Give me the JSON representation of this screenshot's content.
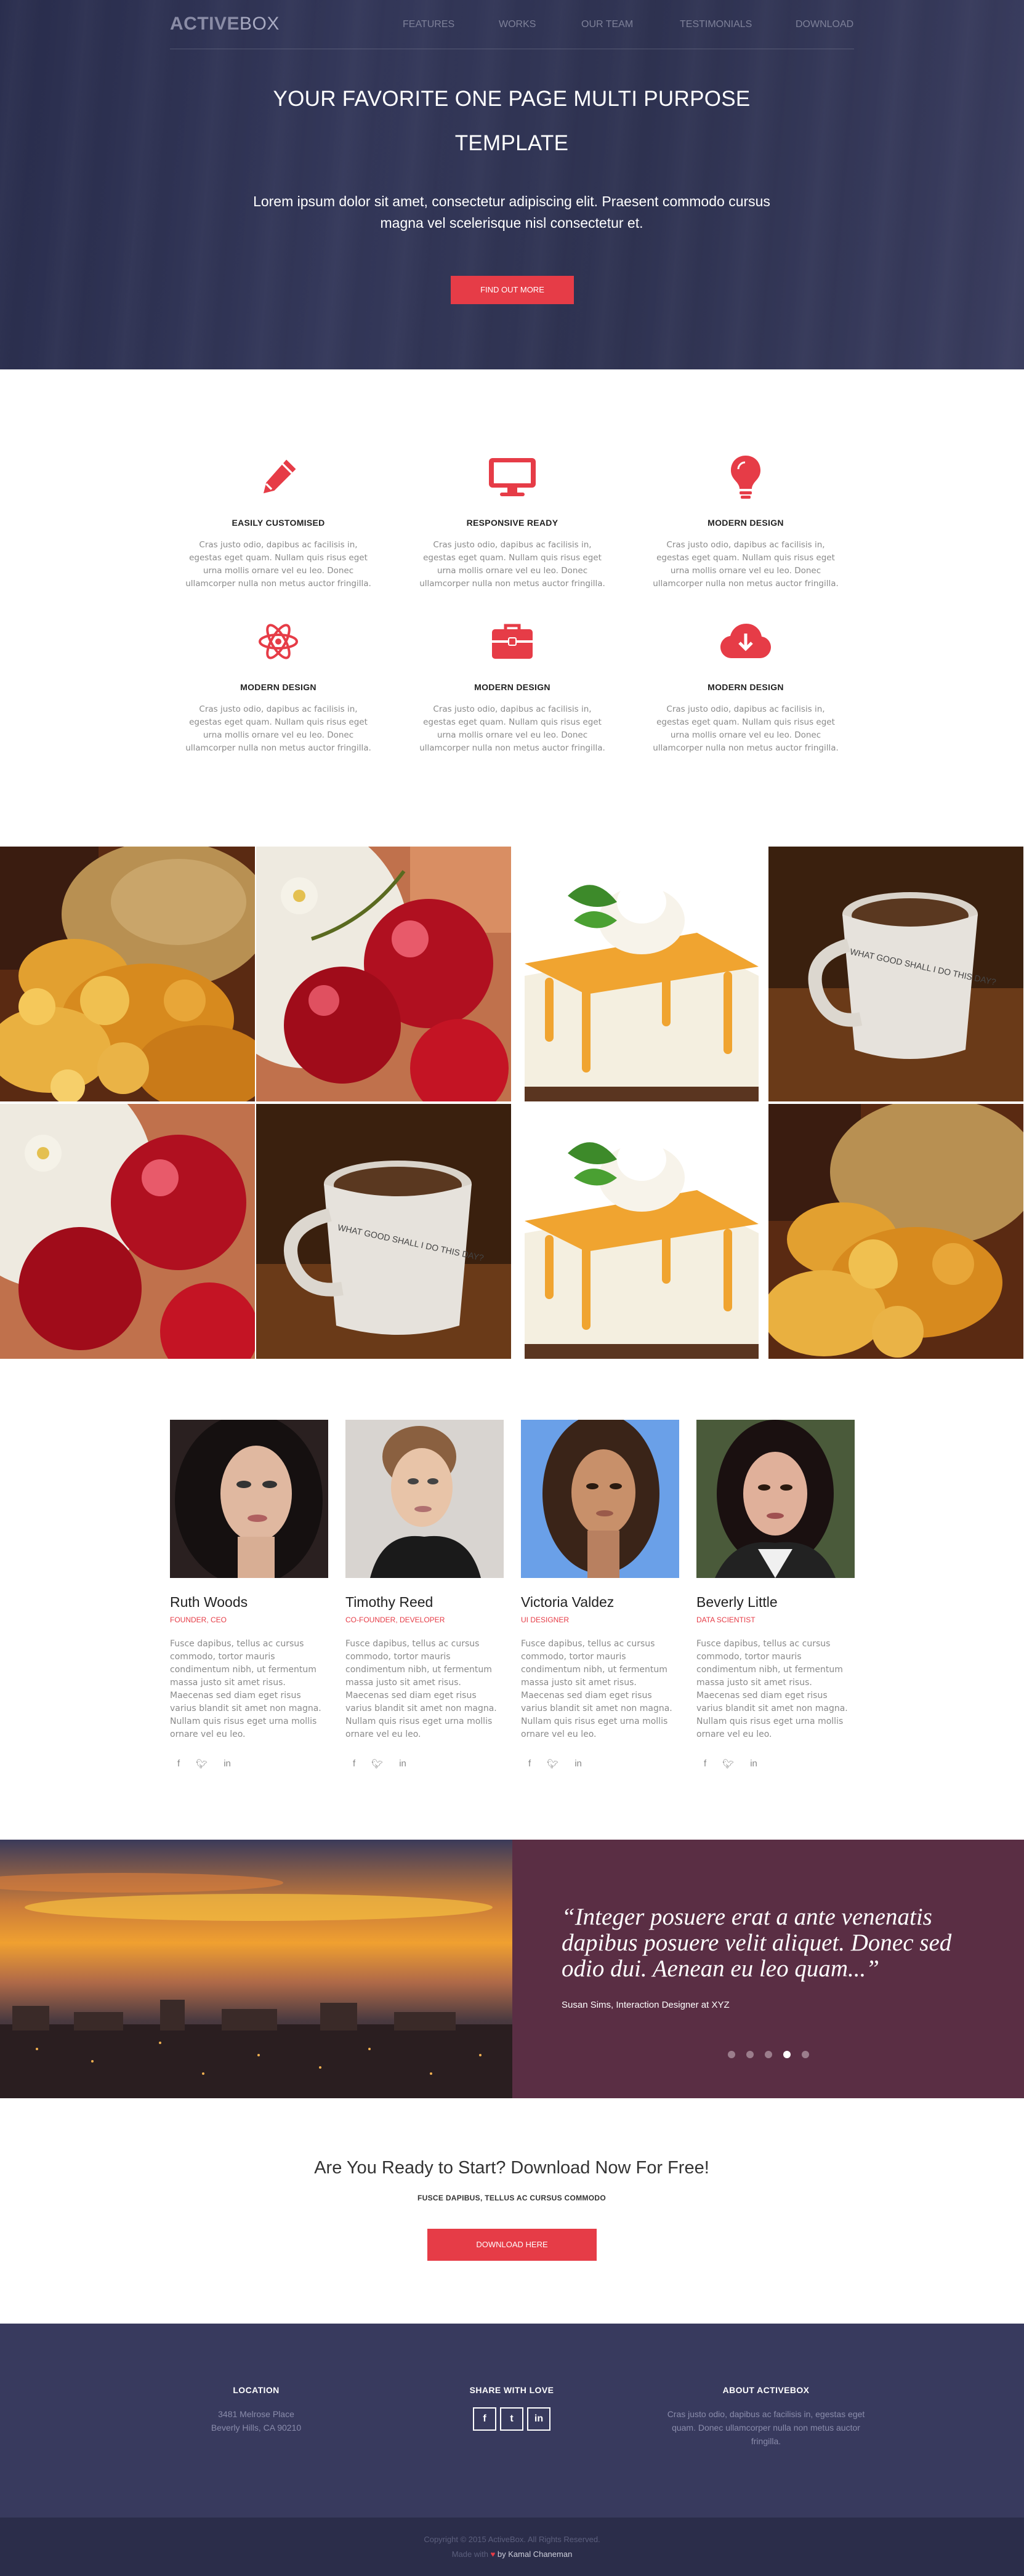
{
  "brand": {
    "logo_bold": "ACTIVE",
    "logo_light": "BOX"
  },
  "nav": {
    "items": [
      "FEATURES",
      "WORKS",
      "OUR TEAM",
      "TESTIMONIALS",
      "DOWNLOAD"
    ]
  },
  "hero": {
    "title_line1": "YOUR FAVORITE ONE PAGE MULTI PURPOSE",
    "title_line2": "TEMPLATE",
    "text": "Lorem ipsum dolor sit amet, consectetur adipiscing elit. Praesent commodo cursus magna vel scelerisque nisl consectetur et.",
    "button": "FIND OUT MORE"
  },
  "features": [
    {
      "title": "EASILY CUSTOMISED",
      "icon": "pencil-icon",
      "text": "Cras justo odio, dapibus ac facilisis in, egestas eget quam. Nullam quis risus eget urna mollis ornare vel eu leo. Donec ullamcorper nulla non metus auctor fringilla."
    },
    {
      "title": "RESPONSIVE READY",
      "icon": "monitor-icon",
      "text": "Cras justo odio, dapibus ac facilisis in, egestas eget quam. Nullam quis risus eget urna mollis ornare vel eu leo. Donec ullamcorper nulla non metus auctor fringilla."
    },
    {
      "title": "MODERN DESIGN",
      "icon": "lightbulb-icon",
      "text": "Cras justo odio, dapibus ac facilisis in, egestas eget quam. Nullam quis risus eget urna mollis ornare vel eu leo. Donec ullamcorper nulla non metus auctor fringilla."
    },
    {
      "title": "MODERN DESIGN",
      "icon": "atom-icon",
      "text": "Cras justo odio, dapibus ac facilisis in, egestas eget quam. Nullam quis risus eget urna mollis ornare vel eu leo. Donec ullamcorper nulla non metus auctor fringilla."
    },
    {
      "title": "MODERN DESIGN",
      "icon": "briefcase-icon",
      "text": "Cras justo odio, dapibus ac facilisis in, egestas eget quam. Nullam quis risus eget urna mollis ornare vel eu leo. Donec ullamcorper nulla non metus auctor fringilla."
    },
    {
      "title": "MODERN DESIGN",
      "icon": "cloud-download-icon",
      "text": "Cras justo odio, dapibus ac facilisis in, egestas eget quam. Nullam quis risus eget urna mollis ornare vel eu leo. Donec ullamcorper nulla non metus auctor fringilla."
    }
  ],
  "gallery": [
    "pastries",
    "cherries",
    "cheesecake",
    "coffee-mug",
    "cherries",
    "coffee-mug",
    "cheesecake",
    "pastries"
  ],
  "mug_text": "WHAT GOOD SHALL I DO THIS DAY?",
  "team": [
    {
      "name": "Ruth Woods",
      "role": "FOUNDER, CEO",
      "text": "Fusce dapibus, tellus ac cursus commodo, tortor mauris condimentum nibh, ut fermentum massa justo sit amet risus. Maecenas sed diam eget risus varius blandit sit amet non magna. Nullam quis risus eget urna mollis ornare vel eu leo."
    },
    {
      "name": "Timothy Reed",
      "role": "CO-FOUNDER, DEVELOPER",
      "text": "Fusce dapibus, tellus ac cursus commodo, tortor mauris condimentum nibh, ut fermentum massa justo sit amet risus. Maecenas sed diam eget risus varius blandit sit amet non magna. Nullam quis risus eget urna mollis ornare vel eu leo."
    },
    {
      "name": "Victoria Valdez",
      "role": "UI DESIGNER",
      "text": "Fusce dapibus, tellus ac cursus commodo, tortor mauris condimentum nibh, ut fermentum massa justo sit amet risus. Maecenas sed diam eget risus varius blandit sit amet non magna. Nullam quis risus eget urna mollis ornare vel eu leo."
    },
    {
      "name": "Beverly Little",
      "role": "DATA SCIENTIST",
      "text": "Fusce dapibus, tellus ac cursus commodo, tortor mauris condimentum nibh, ut fermentum massa justo sit amet risus. Maecenas sed diam eget risus varius blandit sit amet non magna. Nullam quis risus eget urna mollis ornare vel eu leo."
    }
  ],
  "social_icons": [
    "facebook-icon",
    "twitter-icon",
    "linkedin-icon"
  ],
  "testimonial": {
    "quote": "“Integer posuere erat a ante venenatis dapibus posuere velit aliquet. Donec sed odio dui. Aenean eu leo quam...”",
    "author": "Susan Sims, Interaction Designer at XYZ",
    "dots": 5,
    "active_dot": 4
  },
  "cta": {
    "title": "Are You Ready to Start? Download Now For Free!",
    "subtitle": "FUSCE DAPIBUS, TELLUS AC CURSUS COMMODO",
    "button": "DOWNLOAD HERE"
  },
  "footer": {
    "location": {
      "title": "LOCATION",
      "line1": "3481 Melrose Place",
      "line2": "Beverly Hills, CA 90210"
    },
    "share": {
      "title": "SHARE WITH LOVE",
      "icons": [
        "f",
        "t",
        "in"
      ]
    },
    "about": {
      "title": "ABOUT ACTIVEBOX",
      "text": "Cras justo odio, dapibus ac facilisis in, egestas eget quam. Donec ullamcorper nulla non metus auctor fringilla."
    },
    "copyright": "Copyright © 2015 ActiveBox. All Rights Reserved.",
    "made_with": "Made with",
    "heart": "♥",
    "author": "by Kamal Chaneman"
  },
  "colors": {
    "accent": "#e63c47",
    "hero_bg": "#2e3252",
    "testimonial_bg": "#5a2e44",
    "footer_bg": "#383a5e",
    "footer_bottom": "#2b2d4a"
  }
}
